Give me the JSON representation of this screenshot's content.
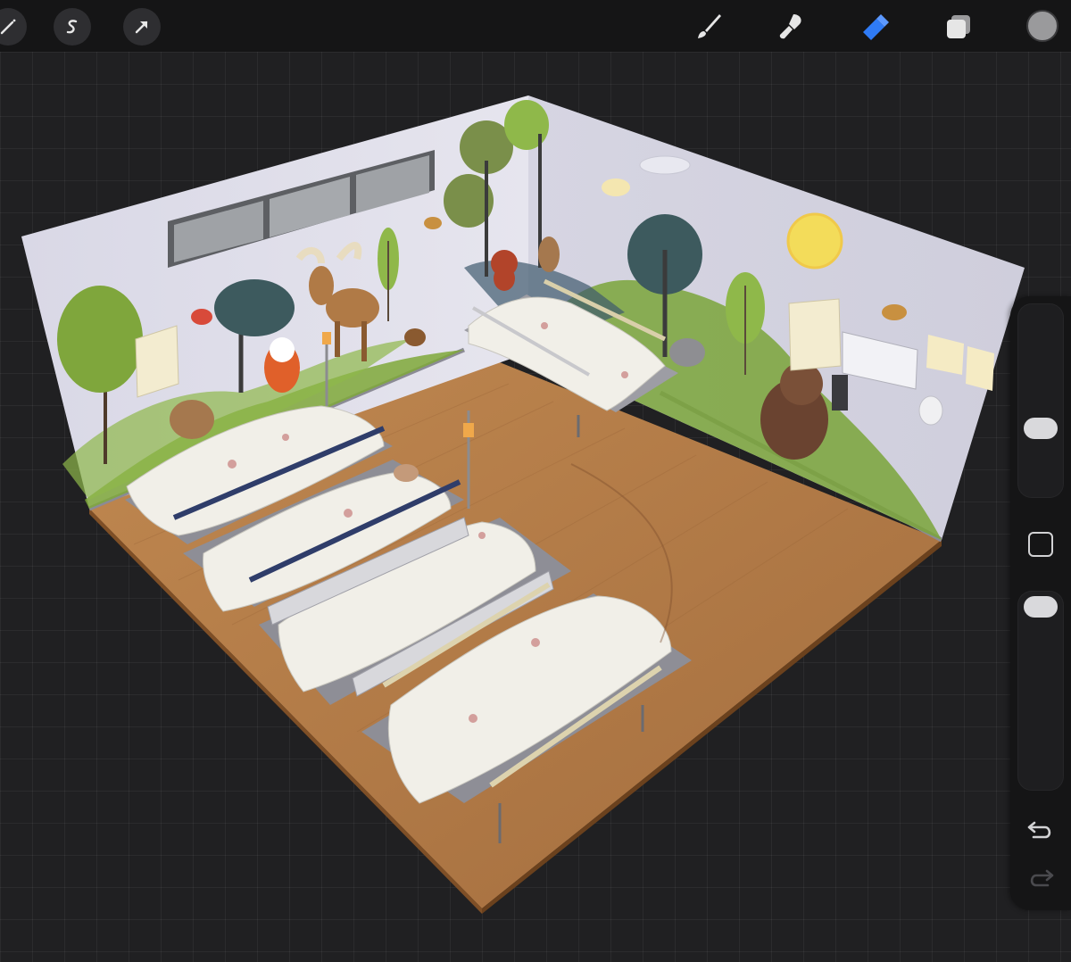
{
  "app": {
    "name": "Procreate"
  },
  "toolbar": {
    "left_tools": [
      {
        "name": "adjustments",
        "icon": "magic-wand-icon"
      },
      {
        "name": "selection",
        "icon": "selection-s-icon"
      },
      {
        "name": "transform",
        "icon": "arrow-cursor-icon"
      }
    ],
    "right_tools": [
      {
        "name": "brush",
        "icon": "brush-icon",
        "active": false
      },
      {
        "name": "smudge",
        "icon": "smudge-icon",
        "active": false
      },
      {
        "name": "eraser",
        "icon": "eraser-icon",
        "active": true
      },
      {
        "name": "layers",
        "icon": "layers-icon",
        "active": false
      }
    ],
    "color": "#9a9a9c",
    "active_color": "#2f7bf5"
  },
  "sidebar": {
    "brush_size_level": 0.3,
    "opacity_level": 0.0,
    "icons": [
      "modify-square-icon",
      "undo-icon",
      "redo-icon"
    ]
  },
  "canvas": {
    "description_hidden": true,
    "wall_color": "#dedee8",
    "floor_color": "#b07a48",
    "beds": 5
  }
}
